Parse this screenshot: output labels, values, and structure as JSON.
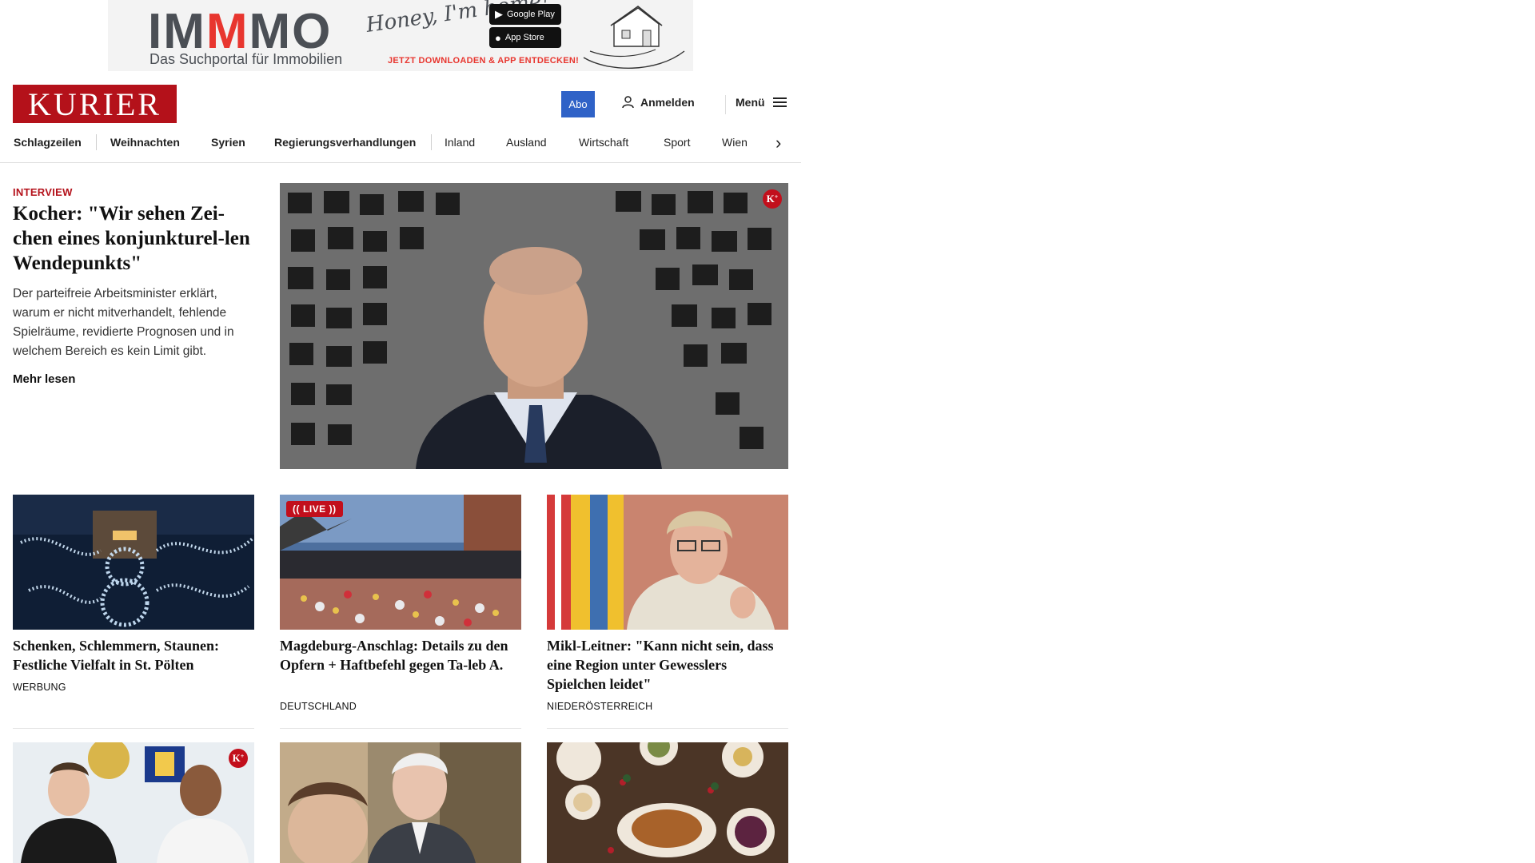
{
  "ad": {
    "brand_prefix": "IM",
    "brand_mid": "M",
    "brand_suffix": "MO",
    "tagline": "Das Suchportal für Immobilien",
    "script": "Honey, I'm home!",
    "store_google": "Google Play",
    "store_apple": "App Store",
    "cta": "JETZT DOWNLOADEN & APP ENTDECKEN!"
  },
  "header": {
    "logo": "KURIER",
    "abo": "Abo",
    "login": "Anmelden",
    "menu": "Menü"
  },
  "nav": {
    "items": [
      "Schlagzeilen",
      "Weihnachten",
      "Syrien",
      "Regierungsverhandlungen",
      "Inland",
      "Ausland",
      "Wirtschaft",
      "Sport",
      "Wien"
    ]
  },
  "hero": {
    "kicker": "INTERVIEW",
    "title": "Kocher: \"Wir sehen Zei-chen eines konjunkturel-len Wendepunkts\"",
    "teaser": "Der parteifreie Arbeitsminister erklärt, warum er nicht mitverhandelt, fehlende Spielräume, revidierte Prognosen und in welchem Bereich es kein Limit gibt.",
    "more": "Mehr lesen",
    "badge": "K"
  },
  "cards": [
    {
      "title": "Schenken, Schlemmern, Staunen: Festliche Vielfalt in St. Pölten",
      "category": "WERBUNG"
    },
    {
      "title": "Magdeburg-Anschlag: Details zu den Opfern + Haftbefehl gegen Ta-leb A.",
      "category": "DEUTSCHLAND",
      "live": "LIVE"
    },
    {
      "title": "Mikl-Leitner: \"Kann nicht sein, dass eine Region unter Gewesslers Spielchen leidet\"",
      "category": "NIEDERÖSTERREICH"
    }
  ],
  "row2_badge": "K"
}
